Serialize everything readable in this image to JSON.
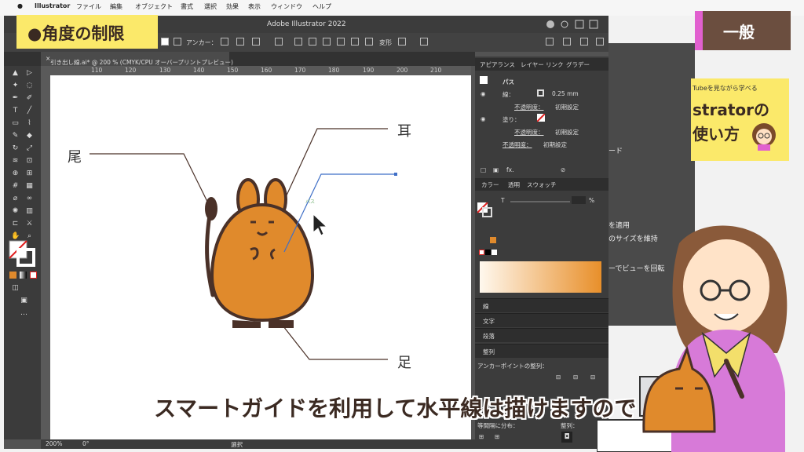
{
  "macos": {
    "menu": [
      "Illustrator",
      "ファイル",
      "編集",
      "オブジェクト",
      "書式",
      "選択",
      "効果",
      "表示",
      "ウィンドウ",
      "ヘルプ"
    ]
  },
  "headline": "●角度の制限",
  "general_tag": "一般",
  "book": {
    "small": "Tubeを見ながら学べる",
    "title1": "strator",
    "title1_suffix": "の",
    "title2": "使い方"
  },
  "background_window": {
    "lines": [
      "ード",
      "を適用",
      "のサイズを維持",
      "ーでビューを回転"
    ]
  },
  "app": {
    "title": "Adobe Illustrator 2022",
    "control_bar": {
      "anchor_label": "アンカー：",
      "transform_label": "変形"
    },
    "doc_tab": "引き出し線.ai* @ 200 % (CMYK/CPU オーバープリントプレビュー)",
    "ruler": [
      "110",
      "120",
      "130",
      "140",
      "150",
      "160",
      "170",
      "180",
      "190",
      "200",
      "210"
    ],
    "status": {
      "zoom": "200%",
      "angle": "0°",
      "mode": "選択"
    }
  },
  "canvas": {
    "labels": {
      "tail": "尾",
      "ear": "耳",
      "foot": "足"
    },
    "guide_label": "パス"
  },
  "appearance_panel": {
    "tabs": [
      "アピアランス",
      "レイヤー",
      "リンク",
      "グラデー"
    ],
    "object": "パス",
    "stroke_label": "線：",
    "stroke_value": "0.25 mm",
    "opacity_label": "不透明度：",
    "opacity_value": "初期設定",
    "fill_label": "塗り："
  },
  "color_panel": {
    "tabs": [
      "カラー",
      "透明",
      "スウォッチ"
    ],
    "t_label": "T",
    "percent": "%"
  },
  "collapsed_panels": [
    "線",
    "文字",
    "段落",
    "整列"
  ],
  "align_panel": {
    "anchor_align": "アンカーポイントの整列：",
    "distribute": "等間隔に分布：",
    "align_to": "整列："
  },
  "subtitle": "スマートガイドを利用して水平線は描けますので",
  "colors": {
    "accent_orange": "#e08a2c",
    "outline": "#4a3128",
    "pink": "#e160cf",
    "yellow": "#fbe96a"
  }
}
